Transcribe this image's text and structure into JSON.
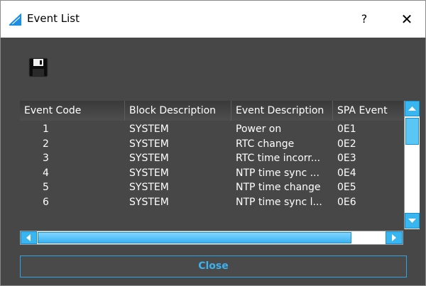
{
  "window": {
    "title": "Event List",
    "help_label": "?",
    "close_label": "✕"
  },
  "grid": {
    "columns": [
      "Event Code",
      "Block Description",
      "Event Description",
      "SPA Event"
    ],
    "rows": [
      [
        "1",
        "SYSTEM",
        "Power on",
        "0E1"
      ],
      [
        "2",
        "SYSTEM",
        "RTC  change",
        "0E2"
      ],
      [
        "3",
        "SYSTEM",
        "RTC time incorr...",
        "0E3"
      ],
      [
        "4",
        "SYSTEM",
        "NTP time sync ...",
        "0E4"
      ],
      [
        "5",
        "SYSTEM",
        "NTP time change",
        "0E5"
      ],
      [
        "6",
        "SYSTEM",
        "NTP time sync l...",
        "0E6"
      ]
    ]
  },
  "footer": {
    "close_button_label": "Close"
  },
  "colors": {
    "background": "#474747",
    "accent": "#39b6f0",
    "text": "#ffffff"
  }
}
